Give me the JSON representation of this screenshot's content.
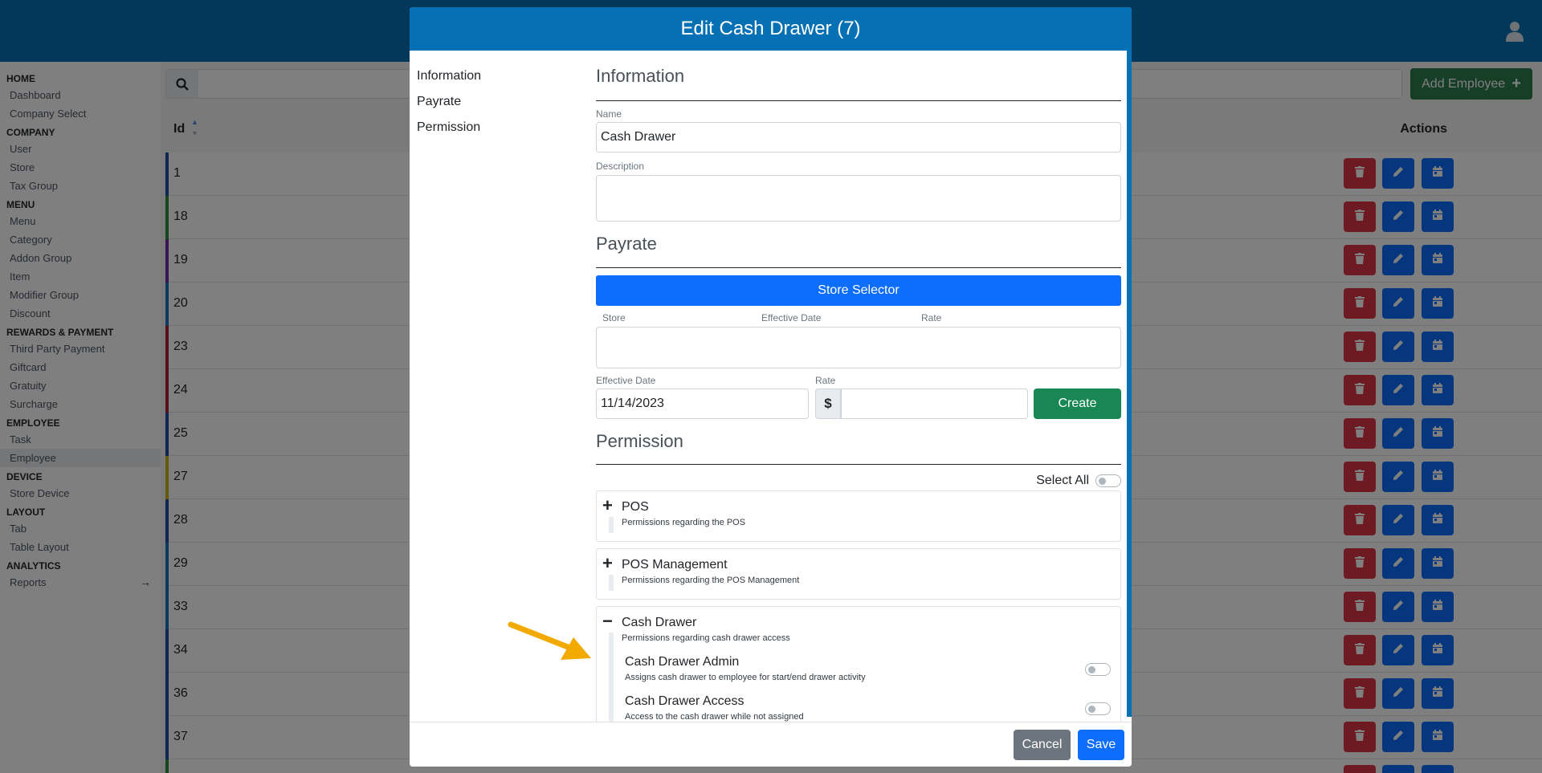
{
  "sidebar": {
    "sections": [
      {
        "heading": "HOME",
        "items": [
          "Dashboard",
          "Company Select"
        ]
      },
      {
        "heading": "COMPANY",
        "items": [
          "User",
          "Store",
          "Tax Group"
        ]
      },
      {
        "heading": "MENU",
        "items": [
          "Menu",
          "Category",
          "Addon Group",
          "Item",
          "Modifier Group",
          "Discount"
        ]
      },
      {
        "heading": "REWARDS & PAYMENT",
        "items": [
          "Third Party Payment",
          "Giftcard",
          "Gratuity",
          "Surcharge"
        ]
      },
      {
        "heading": "EMPLOYEE",
        "items": [
          "Task",
          "Employee"
        ]
      },
      {
        "heading": "DEVICE",
        "items": [
          "Store Device"
        ]
      },
      {
        "heading": "LAYOUT",
        "items": [
          "Tab",
          "Table Layout"
        ]
      },
      {
        "heading": "ANALYTICS",
        "items": [
          "Reports"
        ]
      }
    ],
    "active_item": "Employee"
  },
  "list": {
    "add_button": "Add Employee",
    "col_id": "Id",
    "col_actions": "Actions",
    "rows": [
      {
        "id": "1",
        "color": "#1e4fa0"
      },
      {
        "id": "18",
        "color": "#2e8b3a"
      },
      {
        "id": "19",
        "color": "#6f2da8"
      },
      {
        "id": "20",
        "color": "#1e6fbf"
      },
      {
        "id": "23",
        "color": "#b11e3a"
      },
      {
        "id": "24",
        "color": "#b11e3a"
      },
      {
        "id": "25",
        "color": "#1e4fa0"
      },
      {
        "id": "27",
        "color": "#c9b21e"
      },
      {
        "id": "28",
        "color": "#1e4fa0"
      },
      {
        "id": "29",
        "color": "#1e6fbf"
      },
      {
        "id": "33",
        "color": "#1e6fbf"
      },
      {
        "id": "34",
        "color": "#1e4fa0"
      },
      {
        "id": "36",
        "color": "#1e4fa0"
      },
      {
        "id": "37",
        "color": "#1e4fa0"
      },
      {
        "id": "",
        "color": "#2e8b3a"
      }
    ]
  },
  "modal": {
    "title": "Edit Cash Drawer (7)",
    "nav": [
      "Information",
      "Payrate",
      "Permission"
    ],
    "information": {
      "title": "Information",
      "name_label": "Name",
      "name_value": "Cash Drawer",
      "description_label": "Description",
      "description_value": ""
    },
    "payrate": {
      "title": "Payrate",
      "store_selector": "Store Selector",
      "table_headers": [
        "Store",
        "Effective Date",
        "Rate"
      ],
      "effective_date_label": "Effective Date",
      "effective_date_value": "11/14/2023",
      "rate_label": "Rate",
      "currency": "$",
      "rate_value": "",
      "create_button": "Create"
    },
    "permission": {
      "title": "Permission",
      "select_all": "Select All",
      "groups": [
        {
          "name": "POS",
          "desc": "Permissions regarding the POS",
          "sign": "+"
        },
        {
          "name": "POS Management",
          "desc": "Permissions regarding the POS Management",
          "sign": "+"
        },
        {
          "name": "Cash Drawer",
          "desc": "Permissions regarding cash drawer access",
          "sign": "−",
          "items": [
            {
              "name": "Cash Drawer Admin",
              "desc": "Assigns cash drawer to employee for start/end drawer activity"
            },
            {
              "name": "Cash Drawer Access",
              "desc": "Access to the cash drawer while not assigned"
            }
          ]
        }
      ]
    },
    "footer": {
      "cancel": "Cancel",
      "save": "Save"
    }
  },
  "colors": {
    "header": "#0670b5",
    "primary": "#0d6efd",
    "success": "#198754",
    "danger": "#dc3545",
    "annotation_arrow": "#f2a900"
  }
}
